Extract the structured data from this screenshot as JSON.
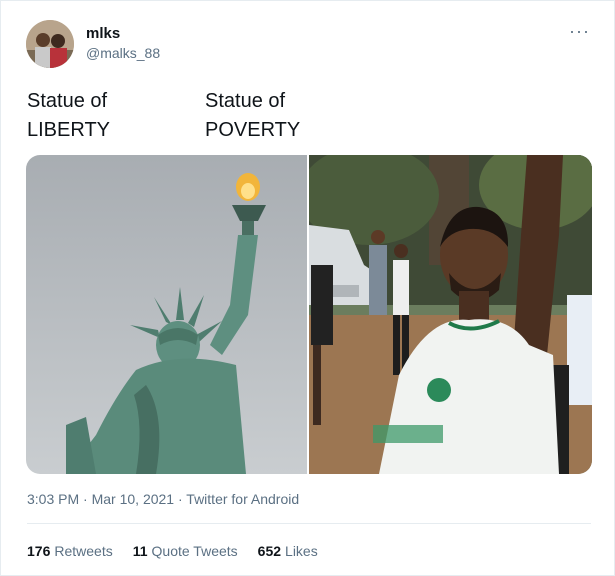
{
  "user": {
    "name": "mlks",
    "handle": "@malks_88"
  },
  "tweet": {
    "caption_left": "Statue of\nLIBERTY",
    "caption_right": "Statue of\nPOVERTY",
    "more_glyph": "···"
  },
  "meta": {
    "time": "3:03 PM",
    "separator": "·",
    "date": "Mar 10, 2021",
    "source": "Twitter for Android"
  },
  "stats": {
    "retweets_count": "176",
    "retweets_label": "Retweets",
    "quotes_count": "11",
    "quotes_label": "Quote Tweets",
    "likes_count": "652",
    "likes_label": "Likes"
  },
  "media": {
    "left_image": "statue-of-liberty-photo",
    "right_image": "man-raising-arm-photo"
  },
  "colors": {
    "text": "#0f1419",
    "secondary": "#5b7083",
    "statue_green": "#5e8f80",
    "sky": "#b9bec2"
  }
}
